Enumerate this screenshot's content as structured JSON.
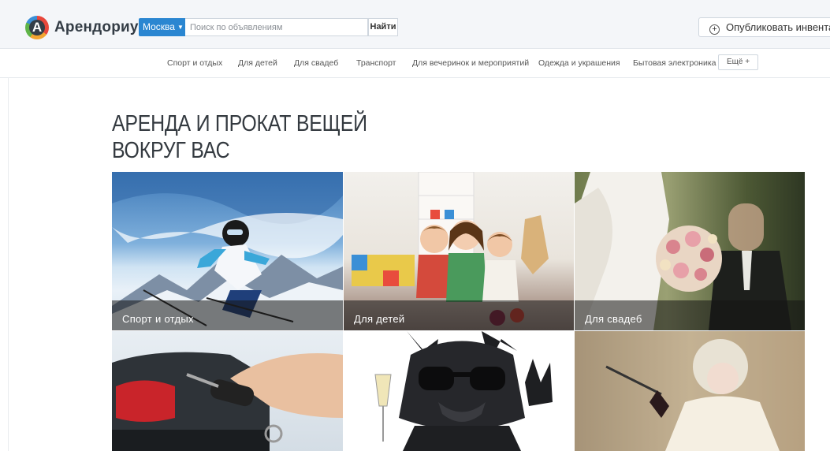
{
  "header": {
    "logo_letter": "А",
    "logo_text": "Арендориум",
    "city": "Москва",
    "search_placeholder": "Поиск по объявлениям",
    "search_button": "Найти",
    "publish_button": "Опубликовать инвентарь"
  },
  "nav": {
    "items": [
      "Спорт и отдых",
      "Для детей",
      "Для свадеб",
      "Транспорт",
      "Для вечеринок и мероприятий",
      "Одежда и украшения",
      "Бытовая электроника"
    ],
    "more": "Ещё +"
  },
  "hero": {
    "title_line1": "АРЕНДА И ПРОКАТ ВЕЩЕЙ",
    "title_line2": "ВОКРУГ ВАС"
  },
  "tiles": [
    {
      "caption": "Спорт и отдых"
    },
    {
      "caption": "Для детей"
    },
    {
      "caption": "Для свадеб"
    }
  ],
  "colors": {
    "accent": "#2a86d1",
    "header_bg": "#f4f6f9"
  }
}
